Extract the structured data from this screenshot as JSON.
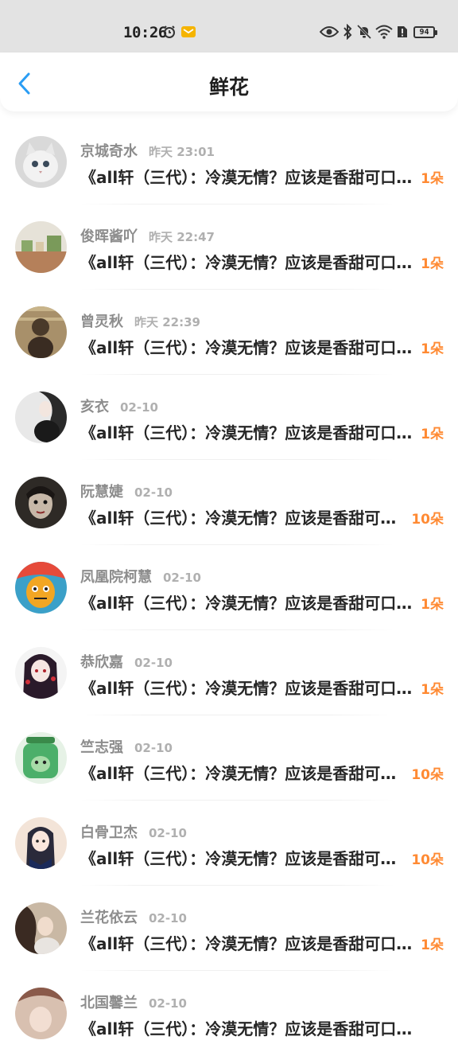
{
  "status_bar": {
    "time": "10:26",
    "battery": "94",
    "icons": [
      "alarm-icon",
      "mail-icon",
      "eye-icon",
      "bluetooth-icon",
      "mute-icon",
      "wifi-icon",
      "sim-icon",
      "battery-icon"
    ],
    "mail_color": "#f5b400"
  },
  "header": {
    "title": "鲜花",
    "back_icon": "chevron-left-icon",
    "back_color": "#2a9df4"
  },
  "accent_color": "#ff8a33",
  "items": [
    {
      "name": "京城奇水",
      "time": "昨天  23:01",
      "title": "《all轩（三代）：冷漠无情？应该是香甜可口吧》",
      "count": "1朵",
      "avatar_colors": [
        "#d9d9d9",
        "#f2f2f2"
      ]
    },
    {
      "name": "俊晖酱吖",
      "time": "昨天  22:47",
      "title": "《all轩（三代）：冷漠无情？应该是香甜可口吧》",
      "count": "1朵",
      "avatar_colors": [
        "#b5805a",
        "#e6e2d8"
      ]
    },
    {
      "name": "曾灵秋",
      "time": "昨天  22:39",
      "title": "《all轩（三代）：冷漠无情？应该是香甜可口吧》",
      "count": "1朵",
      "avatar_colors": [
        "#a8906a",
        "#4a3a2a"
      ]
    },
    {
      "name": "亥衣",
      "time": "02-10",
      "title": "《all轩（三代）：冷漠无情？应该是香甜可口吧》",
      "count": "1朵",
      "avatar_colors": [
        "#e8e8e8",
        "#2a2a2a"
      ]
    },
    {
      "name": "阮慧婕",
      "time": "02-10",
      "title": "《all轩（三代）：冷漠无情？应该是香甜可口吧》",
      "count": "10朵",
      "avatar_colors": [
        "#2e2a26",
        "#c7b8a8"
      ]
    },
    {
      "name": "凤凰院柯慧",
      "time": "02-10",
      "title": "《all轩（三代）：冷漠无情？应该是香甜可口吧》",
      "count": "1朵",
      "avatar_colors": [
        "#f2a623",
        "#3ba0c8"
      ]
    },
    {
      "name": "恭欣嘉",
      "time": "02-10",
      "title": "《all轩（三代）：冷漠无情？应该是香甜可口吧》",
      "count": "1朵",
      "avatar_colors": [
        "#f4f4f4",
        "#2a1a2a"
      ]
    },
    {
      "name": "竺志强",
      "time": "02-10",
      "title": "《all轩（三代）：冷漠无情？应该是香甜可口吧》",
      "count": "10朵",
      "avatar_colors": [
        "#e6f2e6",
        "#4caf6a"
      ]
    },
    {
      "name": "白骨卫杰",
      "time": "02-10",
      "title": "《all轩（三代）：冷漠无情？应该是香甜可口吧》",
      "count": "10朵",
      "avatar_colors": [
        "#f3e4d8",
        "#2a2a3a"
      ]
    },
    {
      "name": "兰花依云",
      "time": "02-10",
      "title": "《all轩（三代）：冷漠无情？应该是香甜可口吧》",
      "count": "1朵",
      "avatar_colors": [
        "#c9b8a4",
        "#3a2a22"
      ]
    },
    {
      "name": "北国馨兰",
      "time": "02-10",
      "title": "《all轩（三代）：冷漠无情？应该是香甜可口吧》",
      "count": "",
      "avatar_colors": [
        "#d8c0b0",
        "#8a5a4a"
      ]
    }
  ]
}
